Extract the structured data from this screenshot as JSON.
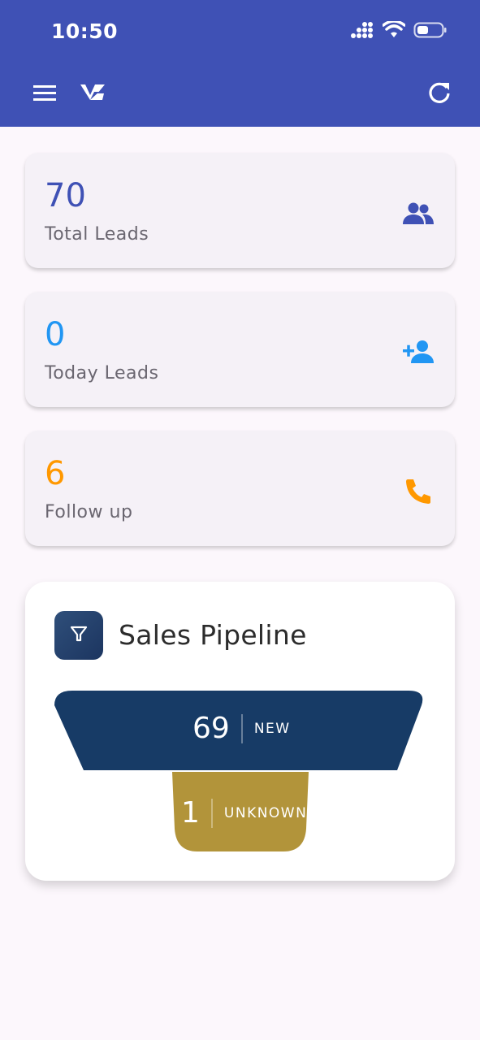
{
  "status_bar": {
    "time": "10:50"
  },
  "toolbar": {
    "menu_icon": "hamburger-icon",
    "logo_icon": "vz-logo",
    "refresh_icon": "refresh-icon"
  },
  "stats": [
    {
      "value": "70",
      "label": "Total Leads",
      "icon": "group-icon",
      "color": "#3f51b5"
    },
    {
      "value": "0",
      "label": "Today Leads",
      "icon": "person-add-icon",
      "color": "#2196f3"
    },
    {
      "value": "6",
      "label": "Follow up",
      "icon": "phone-icon",
      "color": "#ff9800"
    }
  ],
  "pipeline": {
    "title": "Sales Pipeline",
    "icon": "filter-icon",
    "stages": [
      {
        "count": "69",
        "label": "NEW",
        "color": "#173b66"
      },
      {
        "count": "1",
        "label": "UNKNOWN",
        "color": "#b2943a"
      }
    ]
  }
}
